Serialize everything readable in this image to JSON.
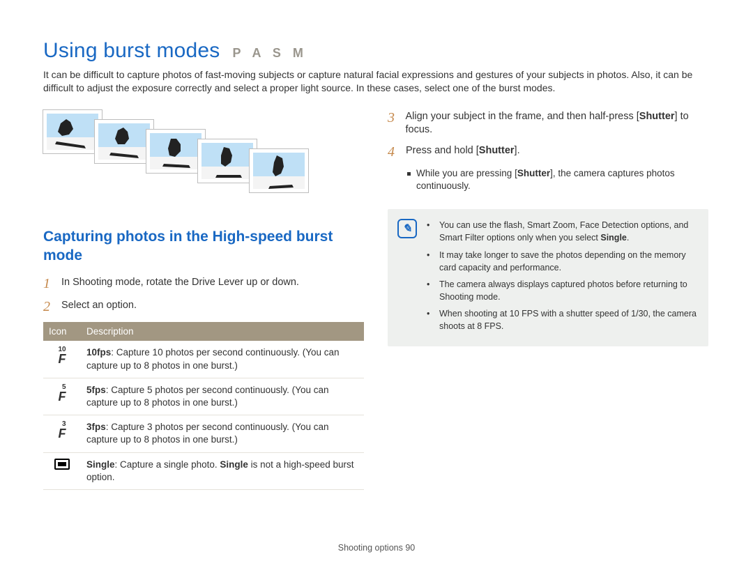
{
  "title": "Using burst modes",
  "modes": "P A S M",
  "intro": "It can be difficult to capture photos of fast-moving subjects or capture natural facial expressions and gestures of your subjects in photos. Also, it can be difficult to adjust the exposure correctly and select a proper light source. In these cases, select one of the burst modes.",
  "subhead": "Capturing photos in the High-speed burst mode",
  "steps_left": {
    "s1": "In Shooting mode, rotate the Drive Lever up or down.",
    "s2": "Select an option."
  },
  "table": {
    "h_icon": "Icon",
    "h_desc": "Description",
    "rows": [
      {
        "num": "10",
        "bold": "10fps",
        "txt": ": Capture 10 photos per second continuously. (You can capture up to 8 photos in one burst.)"
      },
      {
        "num": "5",
        "bold": "5fps",
        "txt": ": Capture 5 photos per second continuously. (You can capture up to 8 photos in one burst.)"
      },
      {
        "num": "3",
        "bold": "3fps",
        "txt": ": Capture 3 photos per second continuously. (You can capture up to 8 photos in one burst.)"
      },
      {
        "num": "",
        "bold": "Single",
        "txt_a": ": Capture a single photo. ",
        "bold2": "Single",
        "txt_b": " is not a high-speed burst option."
      }
    ]
  },
  "steps_right": {
    "s3a": "Align your subject in the frame, and then half-press [",
    "s3b": "Shutter",
    "s3c": "] to focus.",
    "s4a": "Press and hold [",
    "s4b": "Shutter",
    "s4c": "].",
    "sub_a": "While you are pressing [",
    "sub_b": "Shutter",
    "sub_c": "], the camera captures photos continuously."
  },
  "notes": {
    "n1a": "You can use the flash, Smart Zoom, Face Detection options, and Smart Filter options only when you select ",
    "n1b": "Single",
    "n1c": ".",
    "n2": "It may take longer to save the photos depending on the memory card capacity and performance.",
    "n3": "The camera always displays captured photos before returning to Shooting mode.",
    "n4": "When shooting at 10 FPS with a shutter speed of 1/30, the camera shoots at 8 FPS."
  },
  "footer_a": "Shooting options  ",
  "footer_b": "90"
}
